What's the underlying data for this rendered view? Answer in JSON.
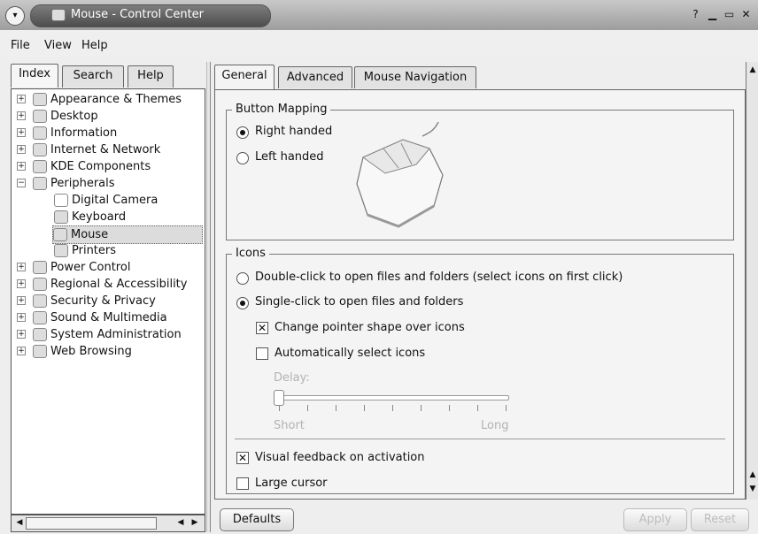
{
  "window": {
    "title": "Mouse - Control Center"
  },
  "menu": {
    "file": "File",
    "view": "View",
    "help": "Help"
  },
  "left_tabs": [
    "Index",
    "Search",
    "Help"
  ],
  "tree": {
    "items": [
      "Appearance & Themes",
      "Desktop",
      "Information",
      "Internet & Network",
      "KDE Components",
      "Peripherals",
      "Digital Camera",
      "Keyboard",
      "Mouse",
      "Printers",
      "Power Control",
      "Regional & Accessibility",
      "Security & Privacy",
      "Sound & Multimedia",
      "System Administration",
      "Web Browsing"
    ],
    "selected": "Mouse"
  },
  "right_tabs": [
    "General",
    "Advanced",
    "Mouse Navigation"
  ],
  "button_mapping": {
    "title": "Button Mapping",
    "right_handed": "Right handed",
    "left_handed": "Left handed",
    "selected": "Right handed"
  },
  "icons_group": {
    "title": "Icons",
    "double_click": "Double-click to open files and folders (select icons on first click)",
    "single_click": "Single-click to open files and folders",
    "selected": "Single-click to open files and folders",
    "change_pointer": "Change pointer shape over icons",
    "change_pointer_checked": true,
    "auto_select": "Automatically select icons",
    "auto_select_checked": false,
    "delay_label": "Delay:",
    "short_label": "Short",
    "long_label": "Long",
    "delay_value": 0,
    "visual_feedback": "Visual feedback on activation",
    "visual_feedback_checked": true,
    "large_cursor": "Large cursor",
    "large_cursor_checked": false
  },
  "buttons": {
    "defaults": "Defaults",
    "apply": "Apply",
    "reset": "Reset"
  }
}
